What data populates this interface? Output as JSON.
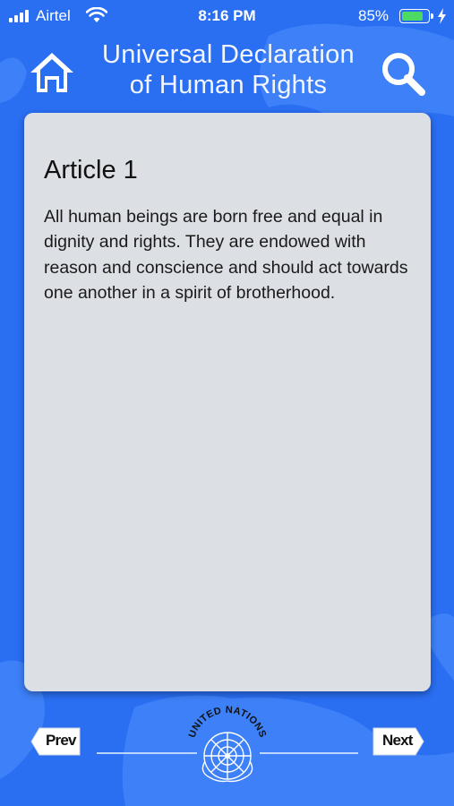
{
  "status_bar": {
    "carrier": "Airtel",
    "time": "8:16 PM",
    "battery_percent": "85%",
    "battery_level": 0.85,
    "battery_color": "#4cd964"
  },
  "header": {
    "title_line1": "Universal Declaration",
    "title_line2": "of Human Rights",
    "home_icon": "home-icon",
    "search_icon": "search-icon"
  },
  "article": {
    "title": "Article 1",
    "body": "All human beings are born free and equal in dignity and rights. They are endowed with reason and conscience and should act towards one another in a spirit of brotherhood."
  },
  "footer": {
    "prev_label": "Prev",
    "next_label": "Next",
    "emblem_text": "UNITED NATIONS"
  },
  "colors": {
    "background": "#2a6ef2",
    "card": "#dcdfe4"
  }
}
